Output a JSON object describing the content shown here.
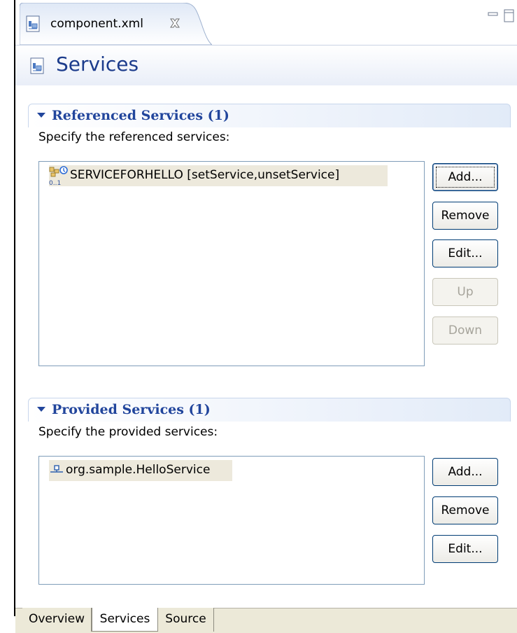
{
  "editor": {
    "tab_title": "component.xml",
    "tab_icon": "component-file-icon",
    "close_icon": "close-icon",
    "minimize_icon": "minimize-icon",
    "maximize_icon": "maximize-icon"
  },
  "header": {
    "title": "Services",
    "icon": "component-file-icon"
  },
  "referenced": {
    "title": "Referenced Services (1)",
    "description": "Specify the referenced services:",
    "items": [
      {
        "label": "SERVICEFORHELLO [setService,unsetService]",
        "icon": "reference-service-icon",
        "cardinality": "0..1"
      }
    ],
    "buttons": {
      "add": "Add...",
      "remove": "Remove",
      "edit": "Edit...",
      "up": "Up",
      "down": "Down"
    }
  },
  "provided": {
    "title": "Provided Services (1)",
    "description": "Specify the provided services:",
    "items": [
      {
        "label": "org.sample.HelloService",
        "icon": "interface-icon"
      }
    ],
    "buttons": {
      "add": "Add...",
      "remove": "Remove",
      "edit": "Edit..."
    }
  },
  "bottom_tabs": [
    {
      "label": "Overview",
      "active": false
    },
    {
      "label": "Services",
      "active": true
    },
    {
      "label": "Source",
      "active": false
    }
  ],
  "colors": {
    "section_title": "#21459c",
    "page_title": "#1c3c8c",
    "selection": "#ede9dc"
  }
}
